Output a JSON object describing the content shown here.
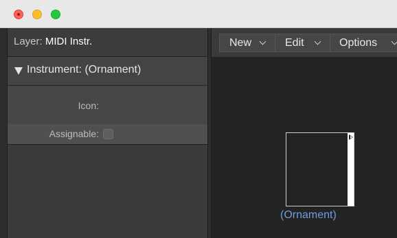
{
  "window": {
    "controls": [
      "close",
      "minimize",
      "zoom"
    ]
  },
  "inspector": {
    "layer_label": "Layer:",
    "layer_value": "MIDI Instr.",
    "section_title": "Instrument:  (Ornament)",
    "icon_label": "Icon:",
    "assignable_label": "Assignable:",
    "assignable_checked": false
  },
  "toolbar": {
    "menus": [
      {
        "label": "New",
        "icon": "chevron-down-icon"
      },
      {
        "label": "Edit",
        "icon": "chevron-down-icon"
      },
      {
        "label": "Options",
        "icon": "chevron-down-icon"
      }
    ]
  },
  "canvas": {
    "object_label": "(Ornament)"
  },
  "colors": {
    "accent_label": "#6e9ee0",
    "close": "#fe5f57",
    "minimize": "#febc2e",
    "zoom": "#28c840"
  }
}
